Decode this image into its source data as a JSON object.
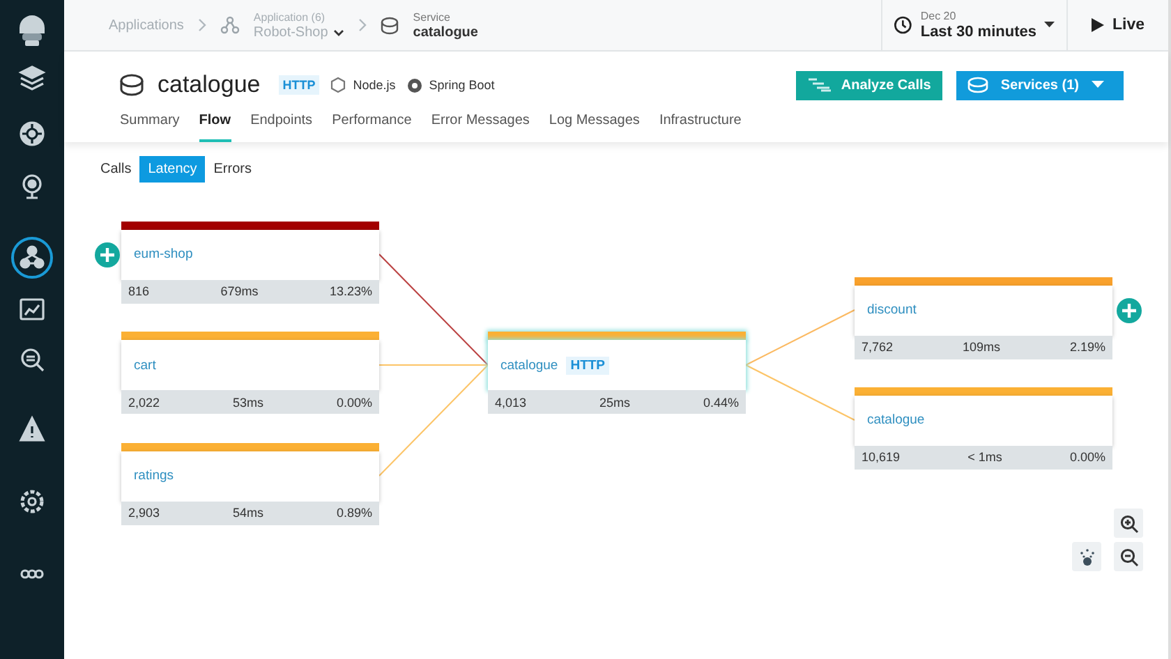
{
  "sidebar": {
    "items": [
      {
        "selected": false
      },
      {
        "selected": false
      },
      {
        "selected": false
      },
      {
        "selected": true
      },
      {
        "selected": false
      },
      {
        "selected": false
      },
      {
        "selected": false
      },
      {
        "selected": false
      },
      {
        "selected": false
      }
    ]
  },
  "breadcrumb": {
    "root": "Applications",
    "application": {
      "label": "Application (6)",
      "value": "Robot-Shop"
    },
    "service": {
      "label": "Service",
      "value": "catalogue"
    }
  },
  "time_range": {
    "date": "Dec 20",
    "label": "Last 30 minutes"
  },
  "live": "Live",
  "service": {
    "name": "catalogue",
    "badge": "HTTP",
    "technologies": [
      "Node.js",
      "Spring Boot"
    ]
  },
  "actions": [
    {
      "label": "Analyze Calls",
      "kind": "analyze"
    },
    {
      "label": "Services (1)",
      "kind": "services"
    }
  ],
  "tabs": [
    {
      "label": "Summary",
      "selected": false
    },
    {
      "label": "Flow",
      "selected": true
    },
    {
      "label": "Endpoints",
      "selected": false
    },
    {
      "label": "Performance",
      "selected": false
    },
    {
      "label": "Error Messages",
      "selected": false
    },
    {
      "label": "Log Messages",
      "selected": false
    },
    {
      "label": "Infrastructure",
      "selected": false
    }
  ],
  "subtabs": [
    {
      "label": "Calls",
      "selected": false
    },
    {
      "label": "Latency",
      "selected": true
    },
    {
      "label": "Errors",
      "selected": false
    }
  ],
  "flow": {
    "callers": [
      {
        "name": "eum-shop",
        "color": "#a30000",
        "calls": "816",
        "latency": "679ms",
        "errors": "13.23%",
        "selected": false,
        "expandable": true
      },
      {
        "name": "cart",
        "color": "#fbb034",
        "calls": "2,022",
        "latency": "53ms",
        "errors": "0.00%",
        "selected": false,
        "expandable": false
      },
      {
        "name": "ratings",
        "color": "#fbb034",
        "calls": "2,903",
        "latency": "54ms",
        "errors": "0.89%",
        "selected": false,
        "expandable": false
      }
    ],
    "service": {
      "name": "catalogue",
      "badge": "HTTP",
      "color": "#fbb034",
      "calls": "4,013",
      "latency": "25ms",
      "errors": "0.44%",
      "selected": true
    },
    "callees": [
      {
        "name": "discount",
        "color": "#f9a12c",
        "calls": "7,762",
        "latency": "109ms",
        "errors": "2.19%",
        "selected": false,
        "expandable": true
      },
      {
        "name": "catalogue",
        "color": "#fbb034",
        "calls": "10,619",
        "latency": "< 1ms",
        "errors": "0.00%",
        "selected": false,
        "expandable": false
      }
    ]
  }
}
